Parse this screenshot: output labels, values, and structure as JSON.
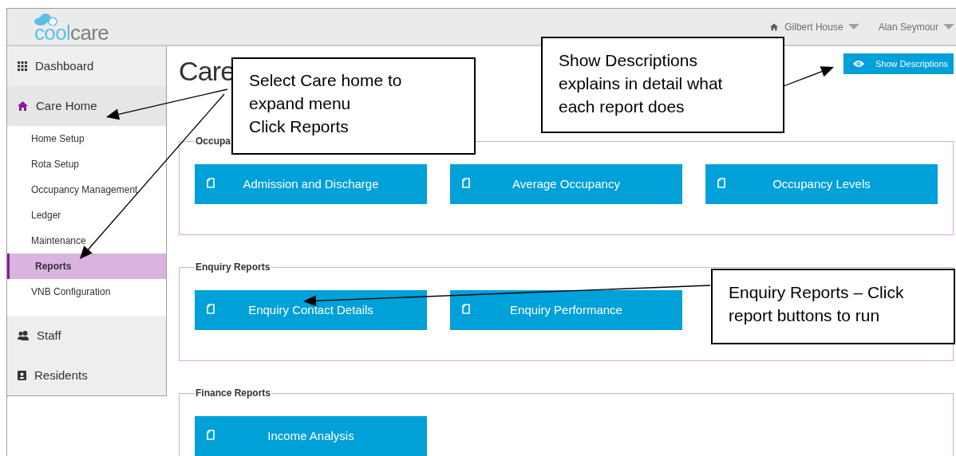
{
  "header": {
    "logo": [
      "cool",
      "care"
    ],
    "home": "Gilbert House",
    "user": "Alan Seymour"
  },
  "sidebar": {
    "items": [
      {
        "label": "Dashboard",
        "kind": "dashboard",
        "selected": false
      },
      {
        "label": "Care Home",
        "kind": "home",
        "selected": true,
        "children": [
          {
            "label": "Home Setup",
            "selected": false
          },
          {
            "label": "Rota Setup",
            "selected": false
          },
          {
            "label": "Occupancy Management",
            "selected": false
          },
          {
            "label": "Ledger",
            "selected": false
          },
          {
            "label": "Maintenance",
            "selected": false
          },
          {
            "label": "Reports",
            "selected": true
          },
          {
            "label": "VNB Configuration",
            "selected": false
          }
        ]
      },
      {
        "label": "Staff",
        "kind": "staff",
        "selected": false
      },
      {
        "label": "Residents",
        "kind": "residents",
        "selected": false
      }
    ]
  },
  "main": {
    "title": "Care",
    "show_descriptions": "Show Descriptions",
    "sections": [
      {
        "label": "Occupa",
        "reports": [
          "Admission and Discharge",
          "Average Occupancy",
          "Occupancy Levels"
        ]
      },
      {
        "label": "Enquiry Reports",
        "reports": [
          "Enquiry Contact Details",
          "Enquiry Performance"
        ]
      },
      {
        "label": "Finance Reports",
        "reports": [
          "Income Analysis"
        ]
      }
    ]
  },
  "annotations": [
    {
      "lines": [
        "Select Care home to",
        "expand menu",
        "Click Reports"
      ]
    },
    {
      "lines": [
        "Show Descriptions",
        "explains in detail what",
        "each report does"
      ]
    },
    {
      "lines": [
        "Enquiry Reports – Click",
        "report buttons to run"
      ]
    }
  ]
}
